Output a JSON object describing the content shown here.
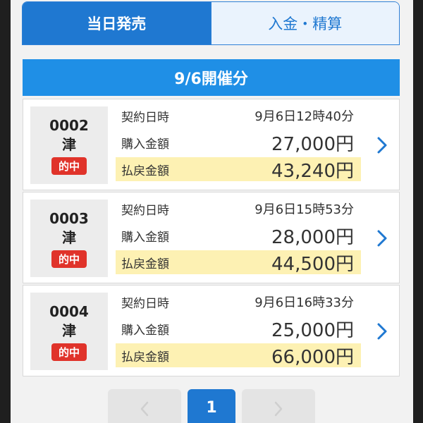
{
  "tabs": [
    {
      "label": "当日発売",
      "active": true
    },
    {
      "label": "入金・精算",
      "active": false
    }
  ],
  "date_header": "9/6開催分",
  "labels": {
    "contract_time": "契約日時",
    "purchase_amount": "購入金額",
    "payout_amount": "払戻金額"
  },
  "cards": [
    {
      "number": "0002",
      "venue": "津",
      "badge": "的中",
      "contract_time": "9月6日12時40分",
      "purchase_amount": "27,000円",
      "payout_amount": "43,240円"
    },
    {
      "number": "0003",
      "venue": "津",
      "badge": "的中",
      "contract_time": "9月6日15時53分",
      "purchase_amount": "28,000円",
      "payout_amount": "44,500円"
    },
    {
      "number": "0004",
      "venue": "津",
      "badge": "的中",
      "contract_time": "9月6日16時33分",
      "purchase_amount": "25,000円",
      "payout_amount": "66,000円"
    }
  ],
  "pagination": {
    "current_page": "1"
  },
  "colors": {
    "primary_blue": "#1f78d1",
    "header_blue": "#1f8fe6",
    "hit_red": "#e0332a",
    "payout_highlight": "#fdf1b3"
  }
}
